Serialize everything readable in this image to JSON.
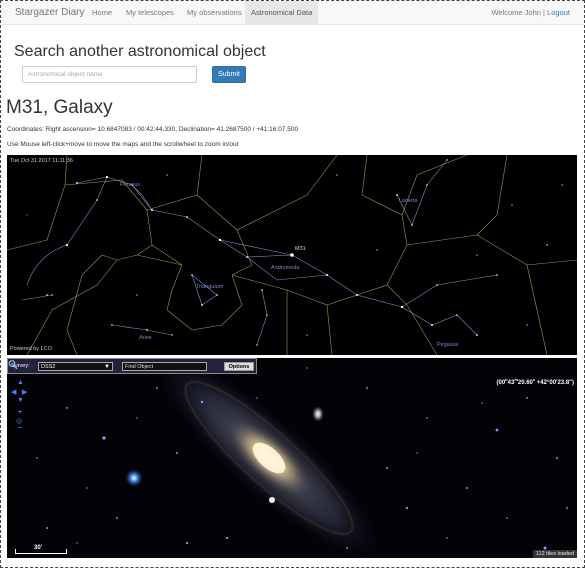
{
  "navbar": {
    "brand": "Stargazer Diary",
    "items": [
      {
        "label": "Home"
      },
      {
        "label": "My telescopes"
      },
      {
        "label": "My observations"
      },
      {
        "label": "Astronomical Data"
      }
    ],
    "welcome": "Welcome John |",
    "logout": "Logout"
  },
  "search": {
    "title": "Search another astronomical object",
    "placeholder": "Astronomical object name",
    "submit_label": "Submit"
  },
  "object": {
    "title": "M31, Galaxy",
    "coordinates": "Coordinates: Right ascension= 10.6847083 / 00:42:44.330, Declination= 41.2687500 / +41:16:07.500",
    "instructions": "Use Mouse left-click+move to move the maps and the scrollwheel to zoom in/out"
  },
  "sky_chart": {
    "date": "Tue Oct 31 2017 11:11:36",
    "powered_by": "Powered by LCO",
    "constellations": [
      "Perseus",
      "Lacerta",
      "Andromeda",
      "Triangulum",
      "Aries",
      "Pegasus"
    ],
    "object_label": "M31"
  },
  "survey_viewer": {
    "survey_label": "Survey:",
    "survey_value": "DSS2",
    "find_placeholder": "Find Object",
    "options_label": "Options",
    "coordinate": {
      "ra_h": "00",
      "ra_m": "43",
      "ra_s": "20.60",
      "dec": "+42°00'23.8\""
    },
    "scale_label": "30'",
    "tiles_loaded": "112 tiles loaded"
  },
  "colors": {
    "accent": "#337ab7",
    "constellation_lines": "#7f8fc9",
    "boundary_lines": "#b5b06a"
  }
}
